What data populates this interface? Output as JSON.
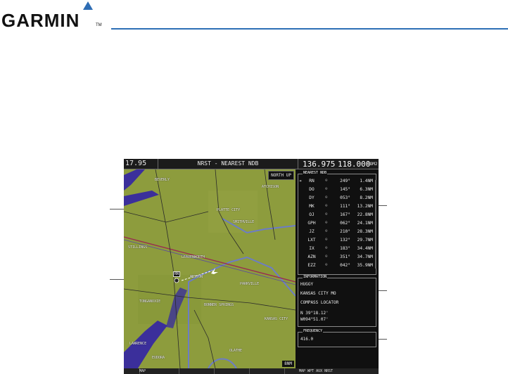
{
  "brand": {
    "name": "GARMIN",
    "tm": "TM"
  },
  "top_bar": {
    "nav_freq": "17.95",
    "page_title": "NRST - NEAREST NDB",
    "com_active": "136.975",
    "com_standby": "118.000",
    "com_label": "COM2"
  },
  "map": {
    "orientation": "NORTH UP",
    "range": "8NM",
    "labels": [
      "BEVERLY",
      "PLATTE CITY",
      "SMITHVILLE",
      "ATCHISON",
      "LEAVENWORTH",
      "WESTON",
      "STILLINGS",
      "TONGANOXIE",
      "BONNER SPRINGS",
      "PARKVILLE",
      "KANSAS CITY",
      "LAWRENCE",
      "EUDORA",
      "OLATHE"
    ],
    "ndb_tag": "RN",
    "colors": {
      "terrain": "#8b9b3c",
      "river": "#3b2f9b",
      "roads": "#2a2a2a",
      "airspace": "#6c7cc6"
    }
  },
  "nearest_ndb": {
    "title": "NEAREST NDB",
    "rows": [
      {
        "arrow": "➔",
        "id": "RN",
        "brg": "249°",
        "dis": "1.4NM"
      },
      {
        "arrow": "",
        "id": "DO",
        "brg": "145°",
        "dis": "6.3NM"
      },
      {
        "arrow": "",
        "id": "DY",
        "brg": "053°",
        "dis": "8.2NM"
      },
      {
        "arrow": "",
        "id": "MK",
        "brg": "111°",
        "dis": "13.2NM"
      },
      {
        "arrow": "",
        "id": "OJ",
        "brg": "167°",
        "dis": "22.8NM"
      },
      {
        "arrow": "",
        "id": "GPH",
        "brg": "062°",
        "dis": "24.1NM"
      },
      {
        "arrow": "",
        "id": "JZ",
        "brg": "210°",
        "dis": "28.3NM"
      },
      {
        "arrow": "",
        "id": "LXT",
        "brg": "132°",
        "dis": "29.7NM"
      },
      {
        "arrow": "",
        "id": "IX",
        "brg": "183°",
        "dis": "34.4NM"
      },
      {
        "arrow": "",
        "id": "AZN",
        "brg": "351°",
        "dis": "34.7NM"
      },
      {
        "arrow": "",
        "id": "EZZ",
        "brg": "042°",
        "dis": "35.9NM"
      }
    ]
  },
  "information": {
    "title": "INFORMATION",
    "lines": [
      "HUGGY",
      "KANSAS CITY MO",
      "COMPASS LOCATOR",
      "N 39°18.12'",
      "W094°51.07'"
    ]
  },
  "frequency": {
    "title": "FREQUENCY",
    "value": "416.0"
  },
  "softkeys": {
    "map": "MAP",
    "page_groups": "MAP WPT AUX NRST"
  }
}
